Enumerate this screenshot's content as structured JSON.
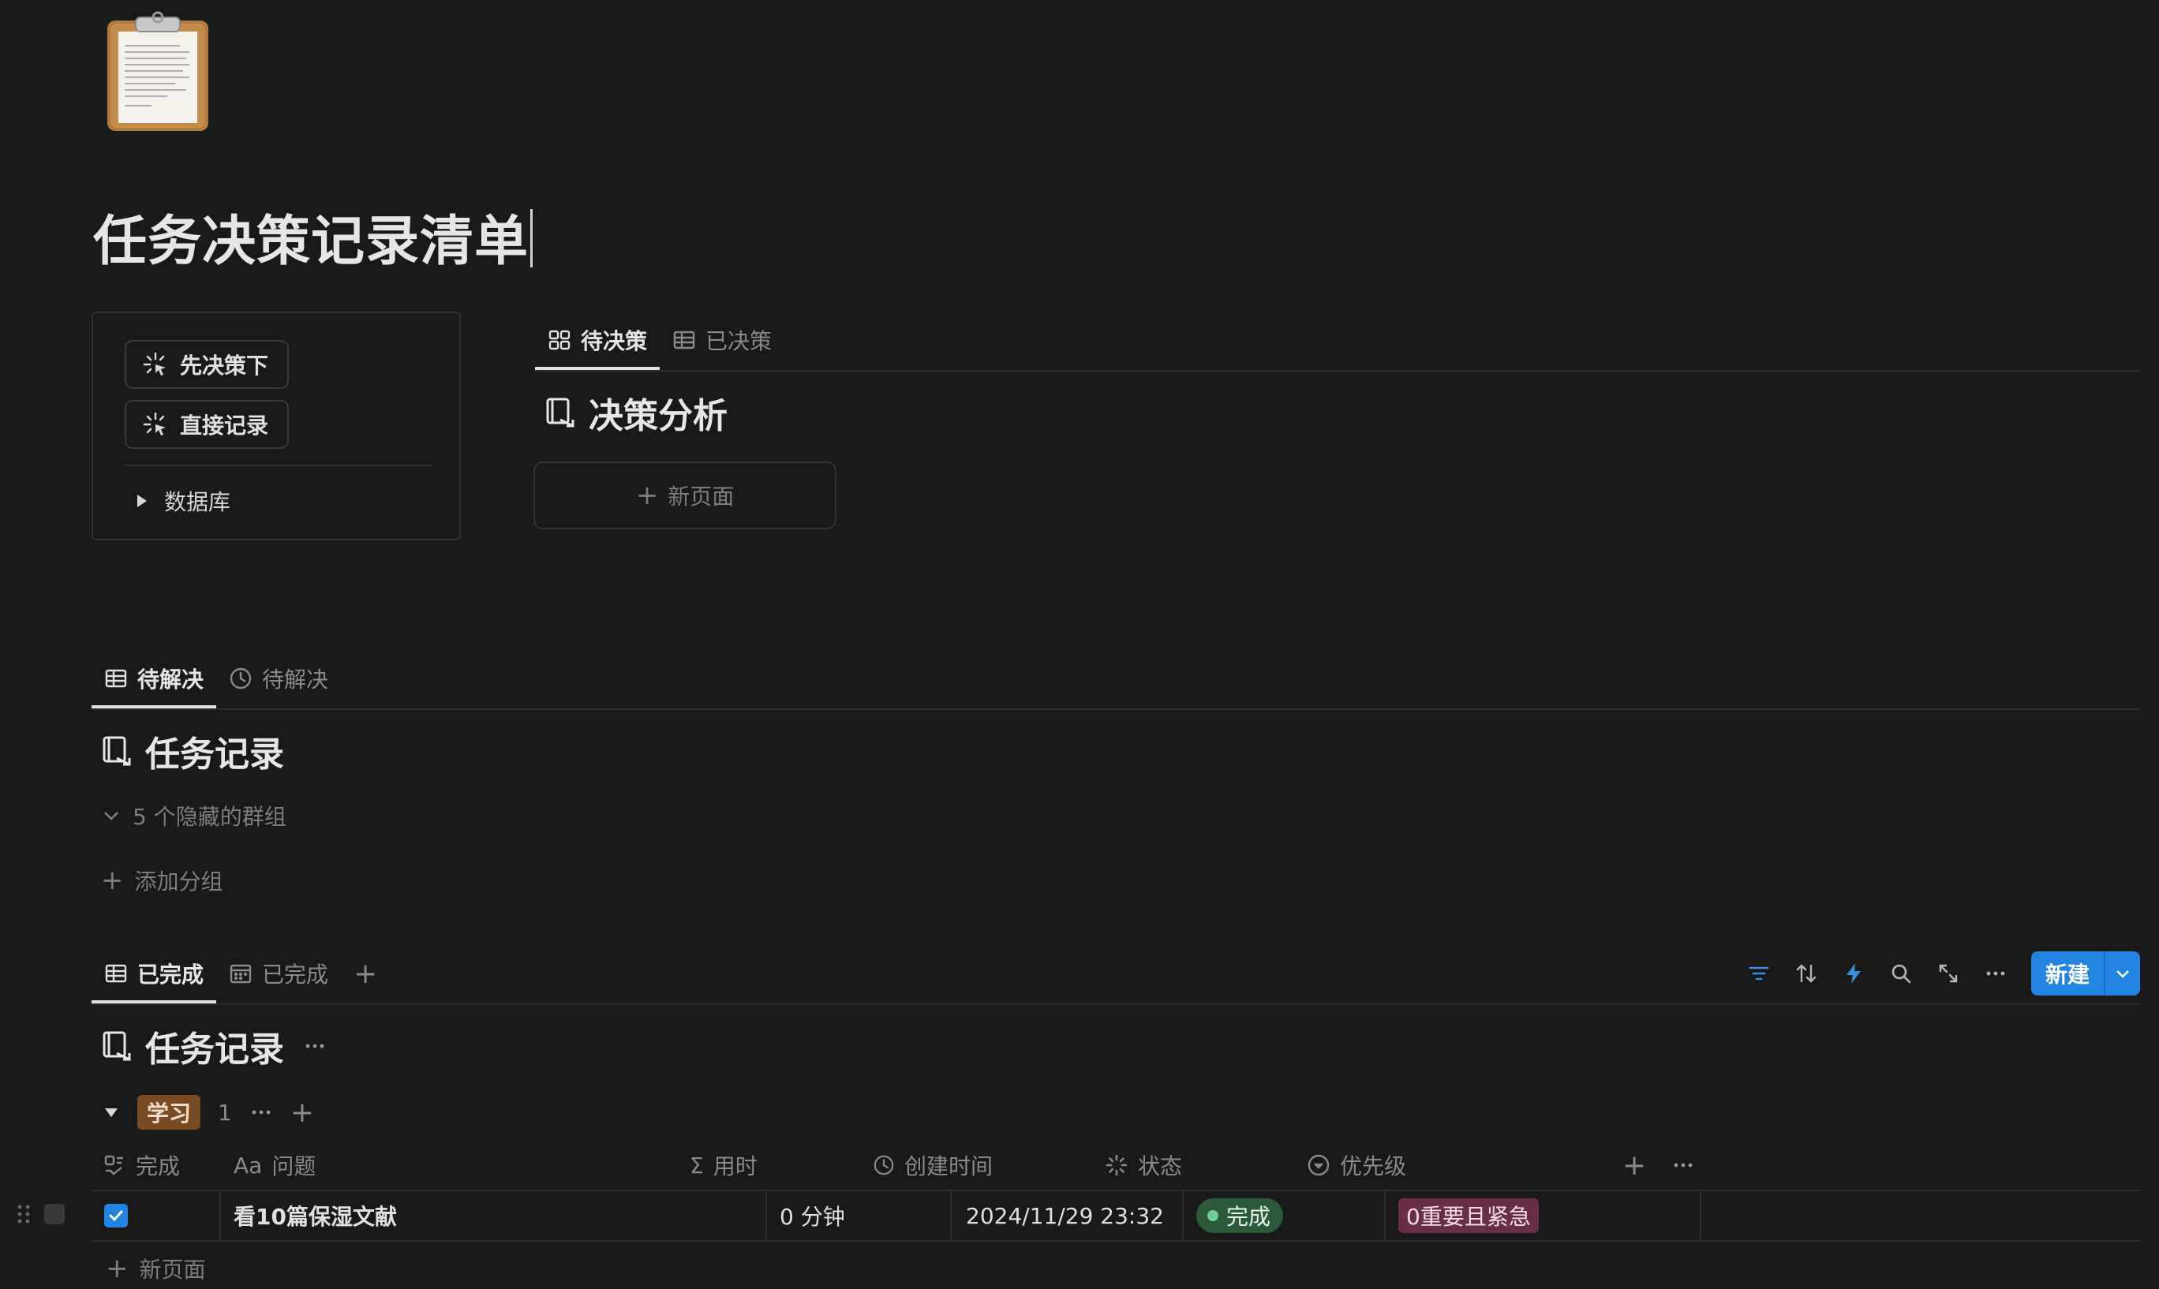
{
  "page": {
    "title": "任务决策记录清单",
    "icon": "clipboard-icon"
  },
  "callout": {
    "buttons": [
      {
        "label": "先决策下",
        "icon": "sparkle-click-icon"
      },
      {
        "label": "直接记录",
        "icon": "sparkle-click-icon"
      }
    ],
    "toggle_label": "数据库"
  },
  "decision_view": {
    "tabs": [
      {
        "label": "待决策",
        "icon": "gallery-icon",
        "active": true
      },
      {
        "label": "已决策",
        "icon": "table-icon",
        "active": false
      }
    ],
    "title": "决策分析",
    "new_page_label": "新页面"
  },
  "pending_view": {
    "tabs": [
      {
        "label": "待解决",
        "icon": "table-icon",
        "active": true
      },
      {
        "label": "待解决",
        "icon": "clock-icon",
        "active": false
      }
    ],
    "title": "任务记录",
    "hidden_groups": "5 个隐藏的群组",
    "add_group": "添加分组"
  },
  "done_view": {
    "tabs": [
      {
        "label": "已完成",
        "icon": "table-icon",
        "active": true
      },
      {
        "label": "已完成",
        "icon": "calendar-icon",
        "active": false
      }
    ],
    "title": "任务记录",
    "new_button": "新建",
    "group": {
      "name": "学习",
      "count": "1"
    },
    "columns": [
      {
        "label": "完成",
        "icon": "checkbox-formula-icon"
      },
      {
        "label": "问题",
        "icon": "text-aa-icon",
        "prefix": "Aa"
      },
      {
        "label": "用时",
        "icon": "sigma-icon",
        "prefix": "Σ"
      },
      {
        "label": "创建时间",
        "icon": "clock-icon"
      },
      {
        "label": "状态",
        "icon": "status-icon"
      },
      {
        "label": "优先级",
        "icon": "select-icon"
      }
    ],
    "rows": [
      {
        "done": true,
        "question": "看10篇保湿文献",
        "duration": "0 分钟",
        "created": "2024/11/29 23:32",
        "status": "完成",
        "priority": "0重要且紧急"
      }
    ],
    "new_row_label": "新页面"
  },
  "colors": {
    "background": "#191919",
    "accent": "#2383e2",
    "status_done": "#2b5a3a",
    "priority_urgent": "#6a2d48",
    "group_tag": "#7a4a22"
  }
}
